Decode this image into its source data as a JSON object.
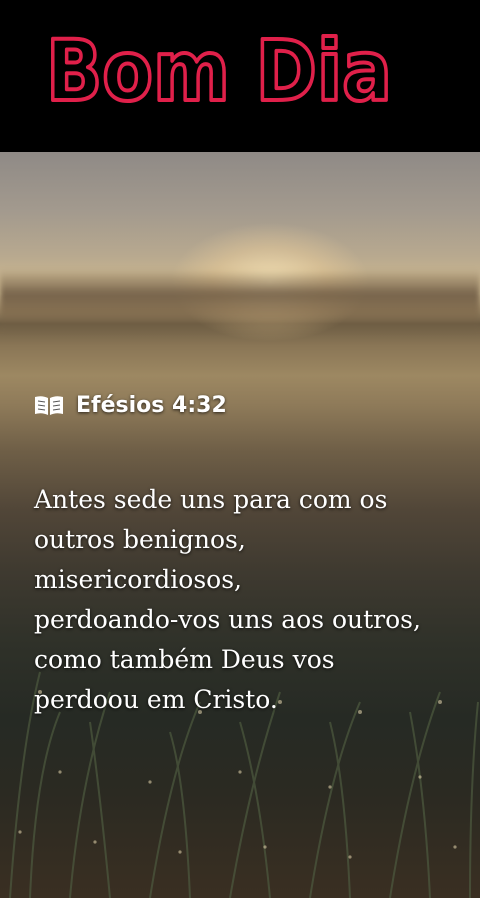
{
  "header": {
    "title": "Bom Dia",
    "title_fill": "#000000",
    "title_stroke": "#e0204a"
  },
  "card": {
    "reference_icon": "open-book-icon",
    "reference": "Efésios 4:32",
    "verse_lines": [
      "Antes sede uns para com os",
      "outros benignos,",
      "misericordiosos,",
      "perdoando-vos uns aos outros,",
      "como também Deus vos",
      "perdoou em Cristo."
    ]
  }
}
